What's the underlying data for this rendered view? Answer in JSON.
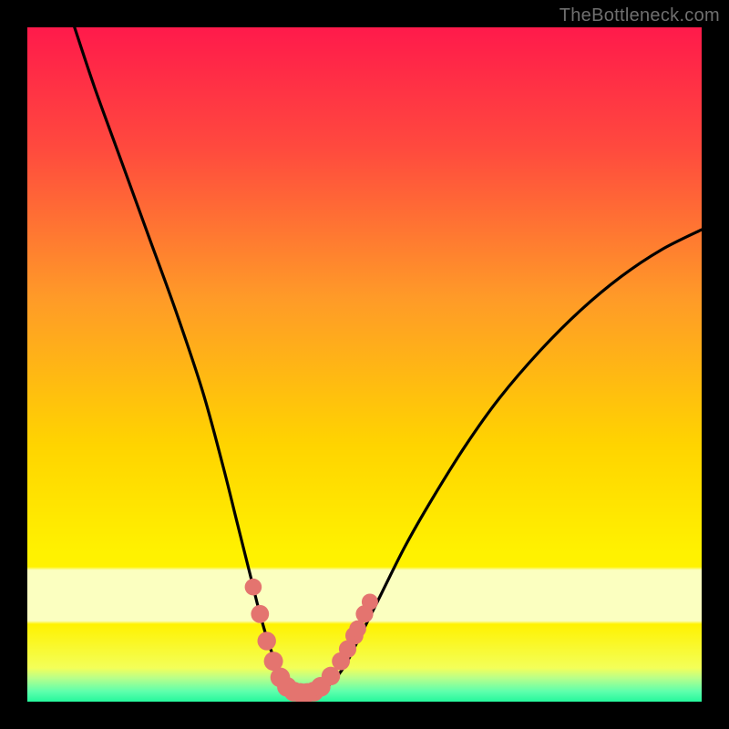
{
  "credit": "TheBottleneck.com",
  "colors": {
    "frame": "#000000",
    "gradient_top": "#ff1a4b",
    "gradient_mid1": "#ff7a2e",
    "gradient_mid2": "#ffd400",
    "gradient_mid3": "#fff200",
    "gradient_band": "#fbffc0",
    "gradient_green1": "#b8ff8a",
    "gradient_green2": "#2bff9d",
    "curve_color": "#000000",
    "marker_fill": "#e4746f",
    "marker_stroke": "#d95a55"
  },
  "chart_data": {
    "type": "line",
    "title": "",
    "xlabel": "",
    "ylabel": "",
    "xlim": [
      0,
      100
    ],
    "ylim": [
      0,
      100
    ],
    "series": [
      {
        "name": "bottleneck-curve",
        "x": [
          7,
          10,
          14,
          18,
          22,
          26,
          29,
          31,
          33,
          34.5,
          36,
          37.5,
          39,
          40.5,
          42,
          43.5,
          45,
          47,
          49,
          52,
          56,
          60,
          65,
          70,
          76,
          82,
          88,
          94,
          100
        ],
        "y": [
          100,
          91,
          80,
          69,
          58,
          46,
          35,
          27,
          19,
          13,
          8,
          4.5,
          2.3,
          1.4,
          1.2,
          1.6,
          2.7,
          5.2,
          9,
          15,
          23,
          30,
          38,
          45,
          52,
          58,
          63,
          67,
          70
        ]
      }
    ],
    "markers": [
      {
        "x": 33.5,
        "y": 17,
        "r": 1.1
      },
      {
        "x": 34.5,
        "y": 13,
        "r": 1.3
      },
      {
        "x": 35.5,
        "y": 9,
        "r": 1.4
      },
      {
        "x": 36.5,
        "y": 6,
        "r": 1.5
      },
      {
        "x": 37.5,
        "y": 3.6,
        "r": 1.6
      },
      {
        "x": 38.5,
        "y": 2.2,
        "r": 1.6
      },
      {
        "x": 39.5,
        "y": 1.5,
        "r": 1.6
      },
      {
        "x": 40.5,
        "y": 1.3,
        "r": 1.6
      },
      {
        "x": 41.5,
        "y": 1.3,
        "r": 1.6
      },
      {
        "x": 42.5,
        "y": 1.5,
        "r": 1.6
      },
      {
        "x": 43.5,
        "y": 2.2,
        "r": 1.6
      },
      {
        "x": 45.0,
        "y": 3.8,
        "r": 1.4
      },
      {
        "x": 46.5,
        "y": 6.0,
        "r": 1.3
      },
      {
        "x": 47.5,
        "y": 7.8,
        "r": 1.2
      },
      {
        "x": 48.5,
        "y": 9.8,
        "r": 1.3
      },
      {
        "x": 49.0,
        "y": 10.8,
        "r": 1.1
      },
      {
        "x": 50.0,
        "y": 13.0,
        "r": 1.2
      },
      {
        "x": 50.8,
        "y": 14.8,
        "r": 1.0
      }
    ],
    "green_band_y": [
      0,
      3
    ],
    "pale_band_y": [
      13,
      22
    ]
  }
}
